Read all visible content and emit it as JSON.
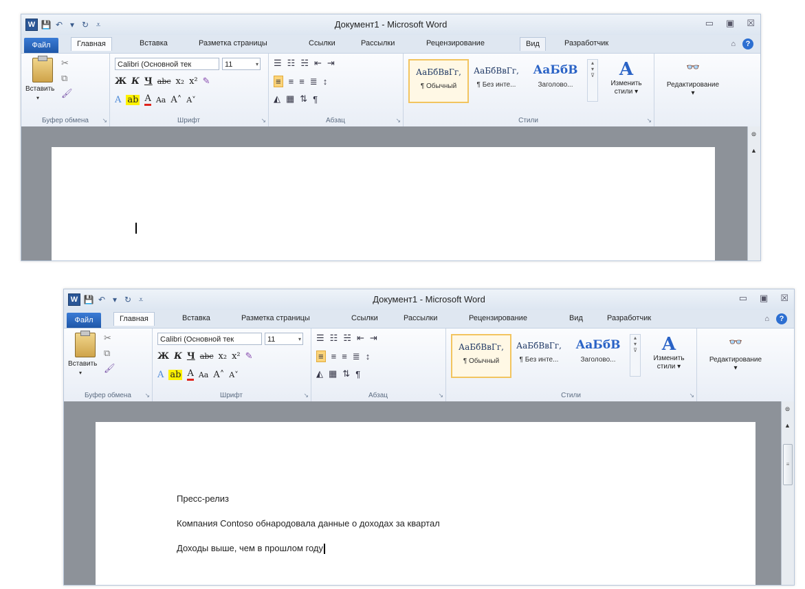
{
  "app": {
    "title": "Документ1 - Microsoft Word",
    "word_logo": "W",
    "win_min": "▭",
    "win_max": "▣",
    "win_close": "☒"
  },
  "tabs": {
    "file": "Файл",
    "home": "Главная",
    "insert": "Вставка",
    "page_layout": "Разметка страницы",
    "references": "Ссылки",
    "mailings": "Рассылки",
    "review": "Рецензирование",
    "view": "Вид",
    "developer": "Разработчик"
  },
  "clipboard": {
    "paste": "Вставить",
    "group": "Буфер обмена"
  },
  "font": {
    "name": "Calibri (Основной тек",
    "size": "11",
    "group": "Шрифт"
  },
  "paragraph": {
    "group": "Абзац"
  },
  "styles": {
    "group": "Стили",
    "items": [
      {
        "sample": "АаБбВвГг,",
        "name": "¶ Обычный"
      },
      {
        "sample": "АаБбВвГг,",
        "name": "¶ Без инте..."
      },
      {
        "sample": "АаБбВ",
        "name": "Заголово..."
      }
    ],
    "change_line1": "Изменить",
    "change_line2": "стили ▾"
  },
  "editing": {
    "label": "Редактирование"
  },
  "document": {
    "lines": [
      "Пресс-релиз",
      "Компания Contoso обнародовала данные о доходах за квартал",
      "Доходы выше, чем в прошлом году"
    ]
  },
  "colors": {
    "file_tab": "#2a6ac8",
    "doc_bg": "#8d9299",
    "ribbon_bg": "#f4f7fb",
    "highlight": "#fbd47a",
    "font_color_bar": "#e0231c"
  },
  "icons": {
    "cut": "cut-icon",
    "copy": "copy-icon",
    "format_painter": "format-painter-icon",
    "binoculars": "binoculars-icon",
    "help": "help-icon"
  }
}
